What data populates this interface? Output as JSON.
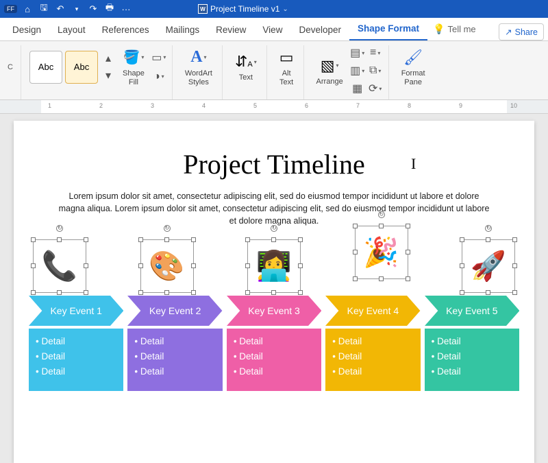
{
  "titlebar": {
    "pill": "FF",
    "doc_name": "Project Timeline v1",
    "icons": {
      "home": "⌂",
      "save": "🖫",
      "undo": "↶",
      "redo": "↷",
      "print": "🖶",
      "more": "···"
    }
  },
  "tabs": {
    "items": [
      "Design",
      "Layout",
      "References",
      "Mailings",
      "Review",
      "View",
      "Developer",
      "Shape Format"
    ],
    "active_index": 7,
    "tell_me": "Tell me",
    "share": "Share"
  },
  "ribbon": {
    "abc": "Abc",
    "shape_fill": "Shape\nFill",
    "wordart": "WordArt\nStyles",
    "text": "Text",
    "alt_text": "Alt\nText",
    "arrange": "Arrange",
    "format_pane": "Format\nPane"
  },
  "ruler": {
    "nums": [
      "1",
      "2",
      "3",
      "4",
      "5",
      "6",
      "7",
      "8",
      "9",
      "10"
    ]
  },
  "doc": {
    "title": "Project Timeline",
    "body": "Lorem ipsum dolor sit amet, consectetur adipiscing elit, sed do eiusmod tempor incididunt ut labore et dolore magna aliqua. Lorem ipsum dolor sit amet, consectetur adipiscing elit, sed do eiusmod tempor incididunt ut labore et dolore magna aliqua."
  },
  "timeline": {
    "items": [
      {
        "emoji": "📞",
        "label": "Key Event 1",
        "color": "#3FC2EA",
        "box": "#3FC2EA",
        "details": [
          "Detail",
          "Detail",
          "Detail"
        ]
      },
      {
        "emoji": "🎨",
        "label": "Key Event 2",
        "color": "#8E6FE0",
        "box": "#8E6FE0",
        "details": [
          "Detail",
          "Detail",
          "Detail"
        ]
      },
      {
        "emoji": "👩‍💻",
        "label": "Key Event 3",
        "color": "#EF5FA7",
        "box": "#EF5FA7",
        "details": [
          "Detail",
          "Detail",
          "Detail"
        ]
      },
      {
        "emoji": "🎉",
        "label": "Key Event 4",
        "color": "#F2B705",
        "box": "#F2B705",
        "details": [
          "Detail",
          "Detail",
          "Detail"
        ],
        "raised": true
      },
      {
        "emoji": "🚀",
        "label": "Key Event 5",
        "color": "#34C5A2",
        "box": "#34C5A2",
        "details": [
          "Detail",
          "Detail",
          "Detail"
        ]
      }
    ]
  }
}
